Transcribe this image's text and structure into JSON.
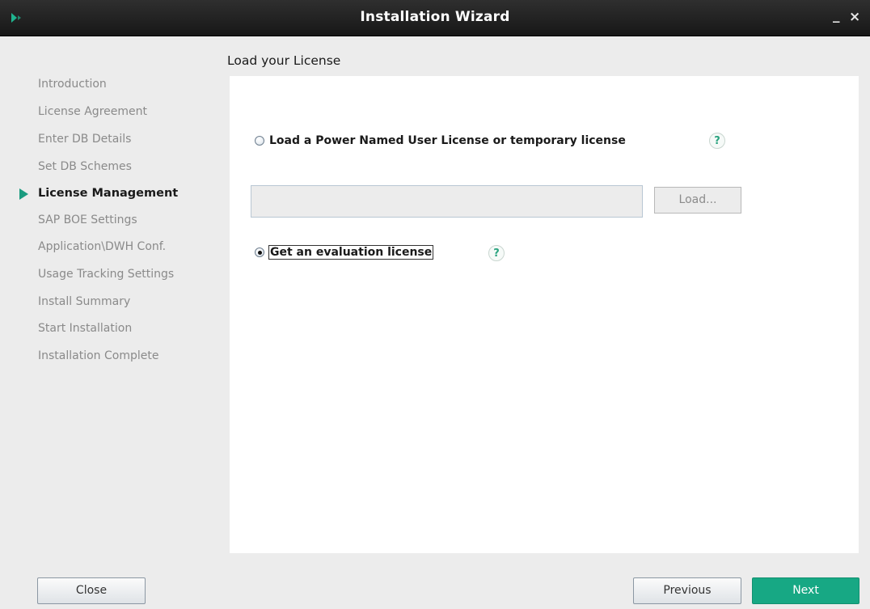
{
  "window": {
    "title": "Installation Wizard",
    "minimize_label": "_",
    "close_label": "×",
    "icon": "app-logo-icon"
  },
  "steps": [
    {
      "label": "Introduction",
      "active": false
    },
    {
      "label": "License Agreement",
      "active": false
    },
    {
      "label": "Enter DB Details",
      "active": false
    },
    {
      "label": "Set DB Schemes",
      "active": false
    },
    {
      "label": "License Management",
      "active": true
    },
    {
      "label": "SAP BOE Settings",
      "active": false
    },
    {
      "label": "Application\\DWH Conf.",
      "active": false
    },
    {
      "label": "Usage Tracking Settings",
      "active": false
    },
    {
      "label": "Install Summary",
      "active": false
    },
    {
      "label": "Start Installation",
      "active": false
    },
    {
      "label": "Installation Complete",
      "active": false
    }
  ],
  "content": {
    "title": "Load your License",
    "option_power_license": {
      "label": "Load a Power Named User License or temporary license",
      "selected": false
    },
    "license_path": {
      "value": "",
      "placeholder": ""
    },
    "load_button": "Load...",
    "option_evaluation": {
      "label": "Get an evaluation license",
      "selected": true
    },
    "help_glyph": "?"
  },
  "footer": {
    "close_label": "Close",
    "previous_label": "Previous",
    "next_label": "Next"
  },
  "colors": {
    "accent": "#17a884",
    "title_bar": "#1f1f1f",
    "panel": "#ffffff",
    "background": "#ececec"
  }
}
